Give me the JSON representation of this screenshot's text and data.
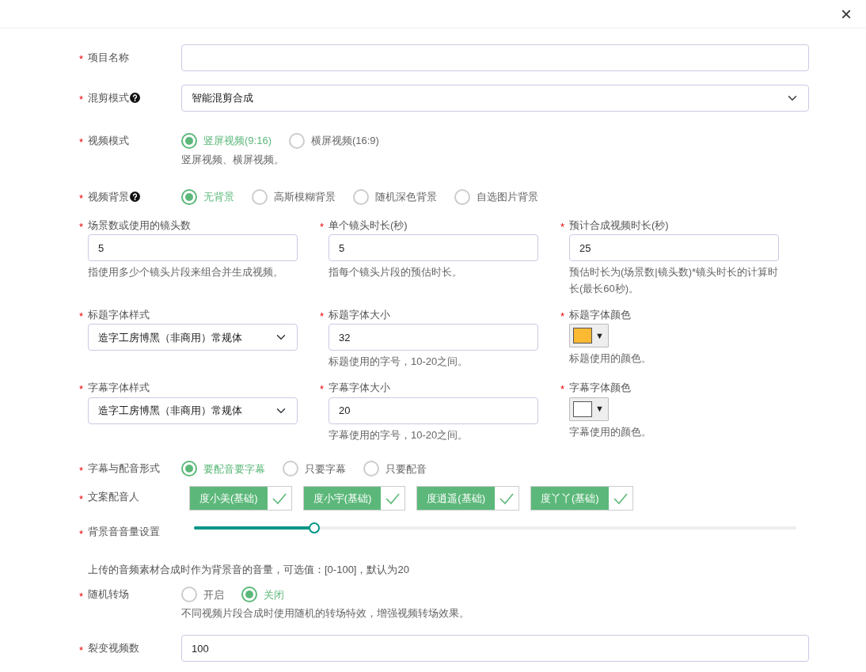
{
  "close_button": "×",
  "required_mark": "*",
  "fields": [
    {
      "kind": "text",
      "label": "项目名称",
      "required": true
    },
    {
      "kind": "select",
      "label": "混剪模式",
      "required": true,
      "help_icon": true,
      "value": "智能混剪合成"
    },
    {
      "kind": "radio",
      "label": "视频模式",
      "required": true,
      "options": [
        {
          "label": "竖屏视频(9:16)",
          "selected": true
        },
        {
          "label": "横屏视频(16:9)",
          "selected": false
        }
      ],
      "hint": "竖屏视频、横屏视频。"
    },
    {
      "kind": "radio",
      "label": "视频背景",
      "required": true,
      "help_icon": true,
      "options": [
        {
          "label": "无背景",
          "selected": true
        },
        {
          "label": "高斯模糊背景",
          "selected": false
        },
        {
          "label": "随机深色背景",
          "selected": false
        },
        {
          "label": "自选图片背景",
          "selected": false
        }
      ]
    },
    {
      "kind": "grid",
      "columns": [
        {
          "kind": "text",
          "label": "场景数或使用的镜头数",
          "required": true,
          "value": "5",
          "hint": "指使用多少个镜头片段来组合并生成视频。"
        },
        {
          "kind": "text",
          "label": "单个镜头时长(秒)",
          "required": true,
          "value": "5",
          "hint": "指每个镜头片段的预估时长。"
        },
        {
          "kind": "text",
          "label": "预计合成视频时长(秒)",
          "required": true,
          "value": "25",
          "hint": "预估时长为(场景数|镜头数)*镜头时长的计算时长(最长60秒)。"
        }
      ]
    },
    {
      "kind": "grid",
      "columns": [
        {
          "kind": "select",
          "label": "标题字体样式",
          "required": true,
          "value": "造字工房博黑（非商用）常规体"
        },
        {
          "kind": "text",
          "label": "标题字体大小",
          "required": true,
          "value": "32",
          "hint": "标题使用的字号，10-20之间。"
        },
        {
          "kind": "color",
          "label": "标题字体颜色",
          "required": true,
          "color": "#fbb934",
          "caret": "▼",
          "hint": "标题使用的颜色。"
        }
      ]
    },
    {
      "kind": "grid",
      "columns": [
        {
          "kind": "select",
          "label": "字幕字体样式",
          "required": true,
          "value": "造字工房博黑（非商用）常规体"
        },
        {
          "kind": "text",
          "label": "字幕字体大小",
          "required": true,
          "value": "20",
          "hint": "字幕使用的字号，10-20之间。"
        },
        {
          "kind": "color",
          "label": "字幕字体颜色",
          "required": true,
          "color": "#ffffff",
          "caret": "▼",
          "hint": "字幕使用的颜色。"
        }
      ]
    },
    {
      "kind": "radio",
      "label": "字幕与配音形式",
      "required": true,
      "options": [
        {
          "label": "要配音要字幕",
          "selected": true
        },
        {
          "label": "只要字幕",
          "selected": false
        },
        {
          "label": "只要配音",
          "selected": false
        }
      ]
    },
    {
      "kind": "voices",
      "label": "文案配音人",
      "required": true,
      "items": [
        {
          "label": "度小美(基础)",
          "selected": true
        },
        {
          "label": "度小宇(基础)",
          "selected": true
        },
        {
          "label": "度逍遥(基础)",
          "selected": true
        },
        {
          "label": "度丫丫(基础)",
          "selected": true
        }
      ]
    },
    {
      "kind": "slider",
      "label": "背景音音量设置",
      "required": true,
      "level": 0.2
    },
    {
      "kind": "note",
      "text": "上传的音频素材合成时作为背景音的音量，可选值：[0-100]，默认为20"
    },
    {
      "kind": "radio",
      "label": "随机转场",
      "required": true,
      "options": [
        {
          "label": "开启",
          "selected": false
        },
        {
          "label": "关闭",
          "selected": true
        }
      ],
      "hint": "不同视频片段合成时使用随机的转场特效，增强视频转场效果。"
    },
    {
      "kind": "text",
      "label": "裂变视频数",
      "required": true,
      "value": "100"
    }
  ]
}
